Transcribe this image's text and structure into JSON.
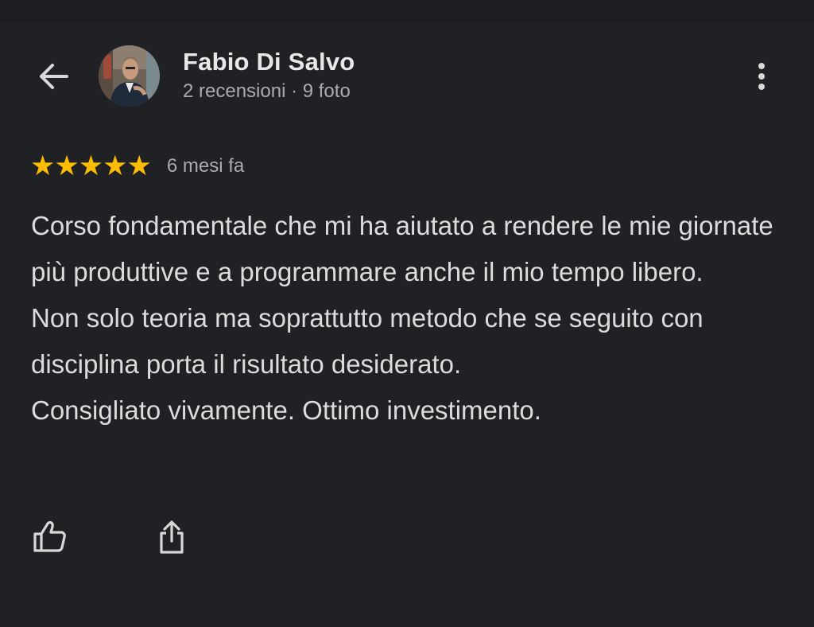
{
  "header": {
    "author_name": "Fabio Di Salvo",
    "author_meta": "2 recensioni · 9 foto"
  },
  "review": {
    "rating": 5,
    "rating_max": 5,
    "stars": "★★★★★",
    "date": "6 mesi fa",
    "paragraphs": [
      "Corso fondamentale che mi ha aiutato a rendere le mie giornate più produttive e a programmare anche il mio tempo libero.",
      "Non solo teoria ma soprattutto metodo che se seguito con disciplina porta il risultato desiderato.",
      "Consigliato vivamente. Ottimo investimento."
    ]
  },
  "icons": {
    "back": "arrow-left-icon",
    "more": "more-vert-icon",
    "like": "thumb-up-icon",
    "share": "share-icon"
  },
  "colors": {
    "background": "#202124",
    "star": "#fbbc04",
    "primary_text": "#e8e8e8",
    "secondary_text": "#a9abaf"
  }
}
